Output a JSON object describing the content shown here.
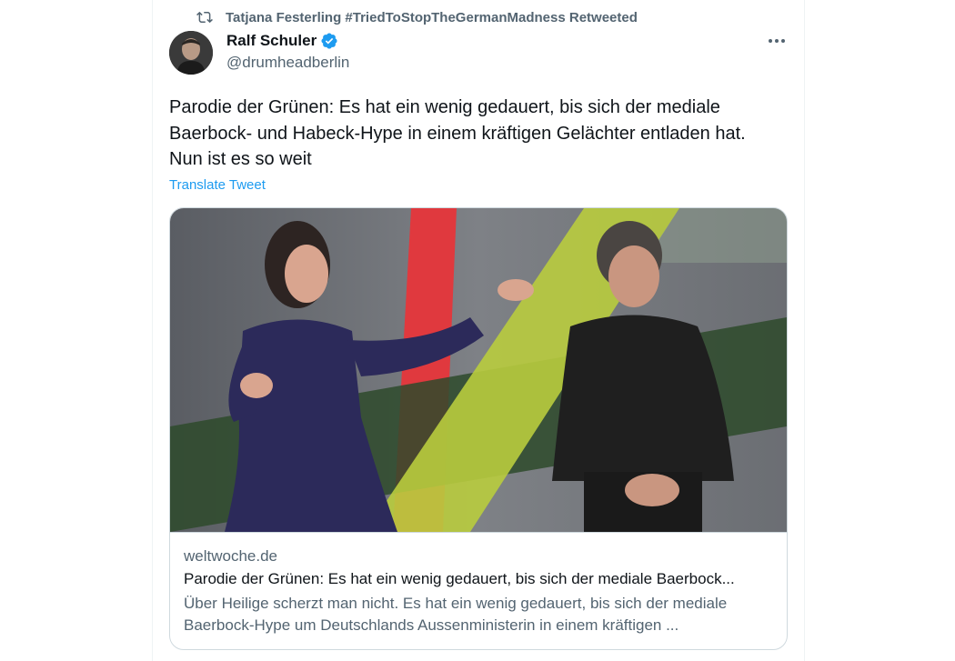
{
  "retweet": {
    "icon": "retweet-icon",
    "text": "Tatjana Festerling #TriedToStopTheGermanMadness Retweeted"
  },
  "author": {
    "name": "Ralf Schuler",
    "handle": "@drumheadberlin",
    "verified_icon": "verified-badge-icon",
    "verified_color": "#1d9bf0"
  },
  "menu": {
    "icon": "more-options-icon"
  },
  "tweet": {
    "text": "Parodie der Grünen: Es hat ein wenig gedauert, bis sich der mediale\nBaerbock- und Habeck-Hype in einem kräftigen Gelächter entladen hat.\nNun ist es so weit",
    "translate_label": "Translate Tweet"
  },
  "link_card": {
    "domain": "weltwoche.de",
    "title": "Parodie der Grünen: Es hat ein wenig gedauert, bis sich der mediale Baerbock...",
    "description": "Über Heilige scherzt man nicht. Es hat ein wenig gedauert, bis sich der mediale Baerbock-Hype um Deutschlands Aussenministerin in einem kräftigen ..."
  },
  "colors": {
    "text_primary": "#0f1419",
    "text_secondary": "#536471",
    "link": "#1d9bf0",
    "border": "#cfd9de"
  }
}
